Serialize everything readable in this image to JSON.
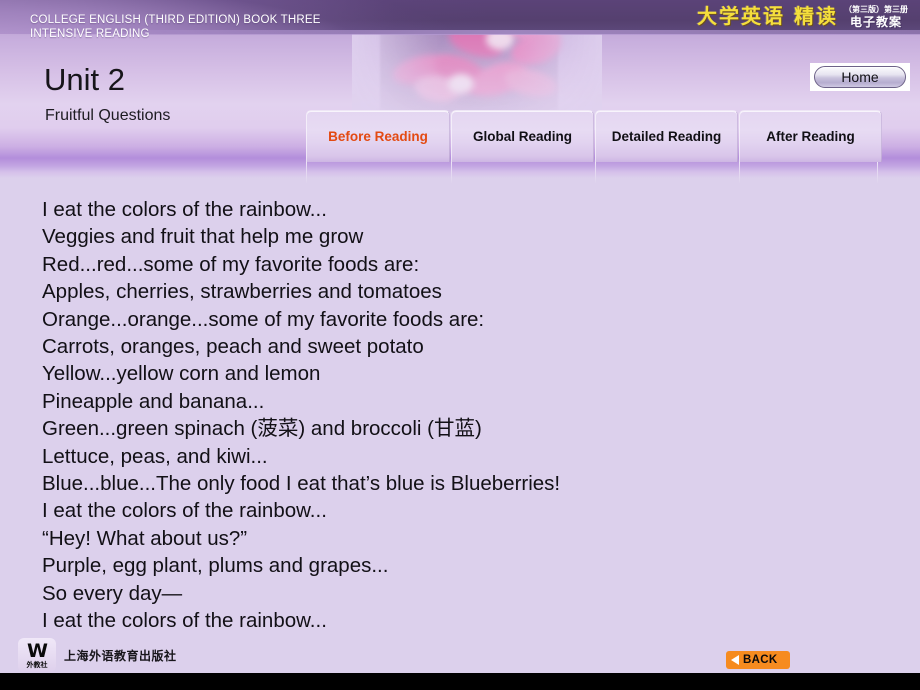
{
  "header": {
    "course_line1": "COLLEGE ENGLISH (THIRD EDITION) BOOK THREE",
    "course_line2": "INTENSIVE READING",
    "unit_title": "Unit 2",
    "unit_subtitle": "Fruitful Questions",
    "home_label": "Home",
    "brand_main": "大学英语 精读",
    "brand_edition": "（第三版）第三册",
    "brand_ebook": "电子教案",
    "decoration_icon": "orchid-flower-image",
    "accent_color": "#E34A12",
    "brand_color": "#F5DF3C"
  },
  "tabs": [
    {
      "label": "Before Reading",
      "active": true
    },
    {
      "label": "Global Reading",
      "active": false
    },
    {
      "label": "Detailed Reading",
      "active": false
    },
    {
      "label": "After Reading",
      "active": false
    }
  ],
  "poem": {
    "lines": [
      "I eat the colors of the rainbow...",
      "Veggies and fruit that help me grow",
      "Red...red...some of my favorite foods are:",
      "Apples, cherries, strawberries and tomatoes",
      "Orange...orange...some of my favorite foods are:",
      "Carrots, oranges, peach and sweet potato",
      "Yellow...yellow corn and lemon",
      "Pineapple and banana...",
      "Green...green spinach (菠菜) and broccoli (甘蓝)",
      "Lettuce, peas, and kiwi...",
      "Blue...blue...The only food I eat that’s blue is Blueberries!",
      "I eat the colors of the rainbow...",
      "“Hey! What about us?”",
      "Purple, egg plant, plums and grapes...",
      "So every day—",
      "I eat the colors of the rainbow..."
    ]
  },
  "footer": {
    "publisher_mark": "W",
    "publisher_mark_cn": "外教社",
    "publisher_name": "上海外语教育出版社",
    "back_label": "BACK",
    "back_icon": "triangle-left-icon",
    "back_color": "#F68B1F"
  }
}
